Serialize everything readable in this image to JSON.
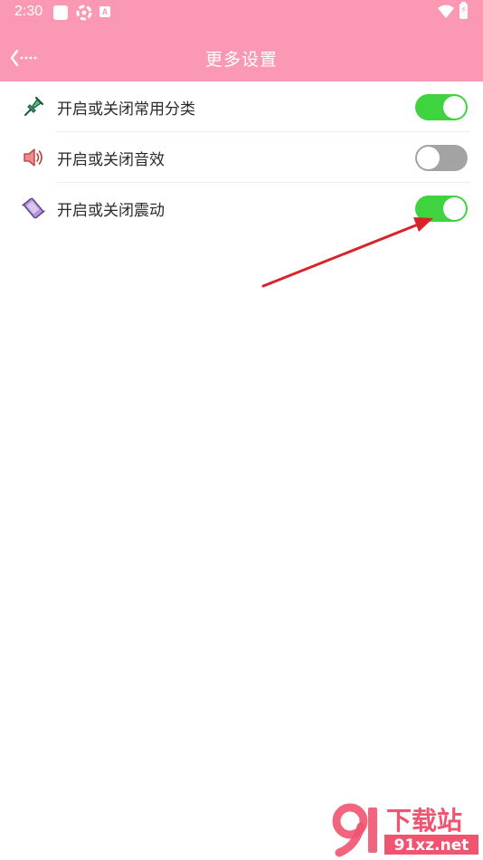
{
  "status_bar": {
    "time": "2:30",
    "icons": [
      "square-icon",
      "gear-icon",
      "a-icon",
      "wifi-icon",
      "battery-icon"
    ],
    "notification_letter": "A",
    "battery_glyph": "⚡"
  },
  "header": {
    "title": "更多设置",
    "background_color": "#fb98b4"
  },
  "settings": [
    {
      "label": "开启或关闭常用分类",
      "icon": "pin-icon",
      "enabled": true
    },
    {
      "label": "开启或关闭音效",
      "icon": "speaker-icon",
      "enabled": false
    },
    {
      "label": "开启或关闭震动",
      "icon": "vibrate-icon",
      "enabled": true
    }
  ],
  "colors": {
    "switch_on": "#3fd33f",
    "switch_off": "#a3a3a3",
    "annotation_arrow": "#d8232a"
  },
  "watermark": {
    "logo_text": "91",
    "brand_text": "下载站",
    "domain_text": "91xz.net"
  }
}
